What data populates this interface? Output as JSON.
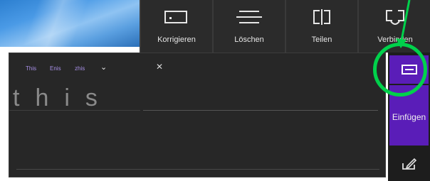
{
  "toolbar": {
    "buttons": [
      {
        "label": "Korrigieren",
        "icon": "correct-icon"
      },
      {
        "label": "Löschen",
        "icon": "strikethrough-icon"
      },
      {
        "label": "Teilen",
        "icon": "split-icon"
      },
      {
        "label": "Verbinden",
        "icon": "join-icon"
      }
    ]
  },
  "handwriting": {
    "suggestions": [
      "This",
      "Enis",
      "zhis"
    ],
    "ink_text": "this"
  },
  "side_buttons": {
    "space_icon": "space-icon",
    "insert_label": "Einfügen",
    "edit_icon": "edit-icon"
  },
  "highlight": {
    "color": "#00d14b"
  },
  "accent_color": "#5a1db8"
}
